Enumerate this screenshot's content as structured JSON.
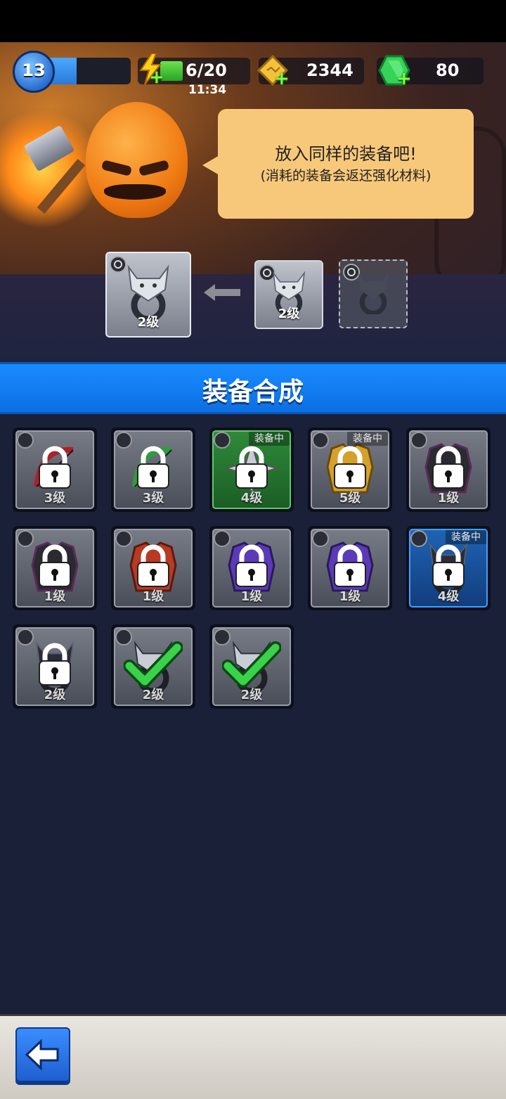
{
  "hud": {
    "player_level": "13",
    "xp_fraction": 0.4,
    "energy": "6/20",
    "energy_timer": "11:34",
    "gold": "2344",
    "gems": "80"
  },
  "npc": {
    "speech_line1": "放入同样的装备吧!",
    "speech_line2": "(消耗的装备会返还强化材料)"
  },
  "merge": {
    "target_level": "2级",
    "material_level": "2级"
  },
  "title": "装备合成",
  "equipment": [
    {
      "level": "3级",
      "type": "weapon",
      "item": "red-bow",
      "locked": true,
      "equipped": false,
      "frame": "gray"
    },
    {
      "level": "3级",
      "type": "weapon",
      "item": "green-bow",
      "locked": true,
      "equipped": false,
      "frame": "gray"
    },
    {
      "level": "4级",
      "type": "weapon",
      "item": "shuriken",
      "locked": true,
      "equipped": true,
      "frame": "green"
    },
    {
      "level": "5级",
      "type": "armor",
      "item": "gold-armor",
      "locked": true,
      "equipped": true,
      "frame": "gray"
    },
    {
      "level": "1级",
      "type": "armor",
      "item": "black-vest",
      "locked": true,
      "equipped": false,
      "frame": "gray"
    },
    {
      "level": "1级",
      "type": "armor",
      "item": "black-vest",
      "locked": true,
      "equipped": false,
      "frame": "gray"
    },
    {
      "level": "1级",
      "type": "armor",
      "item": "red-vest",
      "locked": true,
      "equipped": false,
      "frame": "gray"
    },
    {
      "level": "1级",
      "type": "armor",
      "item": "purple-vest",
      "locked": true,
      "equipped": false,
      "frame": "gray"
    },
    {
      "level": "1级",
      "type": "armor",
      "item": "purple-vest",
      "locked": true,
      "equipped": false,
      "frame": "gray"
    },
    {
      "level": "4级",
      "type": "ring",
      "item": "panda-ring",
      "locked": true,
      "equipped": true,
      "frame": "blue"
    },
    {
      "level": "2级",
      "type": "ring",
      "item": "panda-ring",
      "locked": true,
      "equipped": false,
      "frame": "gray"
    },
    {
      "level": "2级",
      "type": "ring",
      "item": "wolf-ring",
      "locked": false,
      "selected": true,
      "equipped": false,
      "frame": "gray"
    },
    {
      "level": "2级",
      "type": "ring",
      "item": "wolf-ring",
      "locked": false,
      "selected": true,
      "equipped": false,
      "frame": "gray"
    }
  ],
  "equipped_label": "装备中",
  "colors": {
    "accent": "#0b6fe3",
    "bubble": "#f8c87a",
    "background": "#1a2038"
  },
  "icons": {
    "back": "back-arrow-icon"
  }
}
